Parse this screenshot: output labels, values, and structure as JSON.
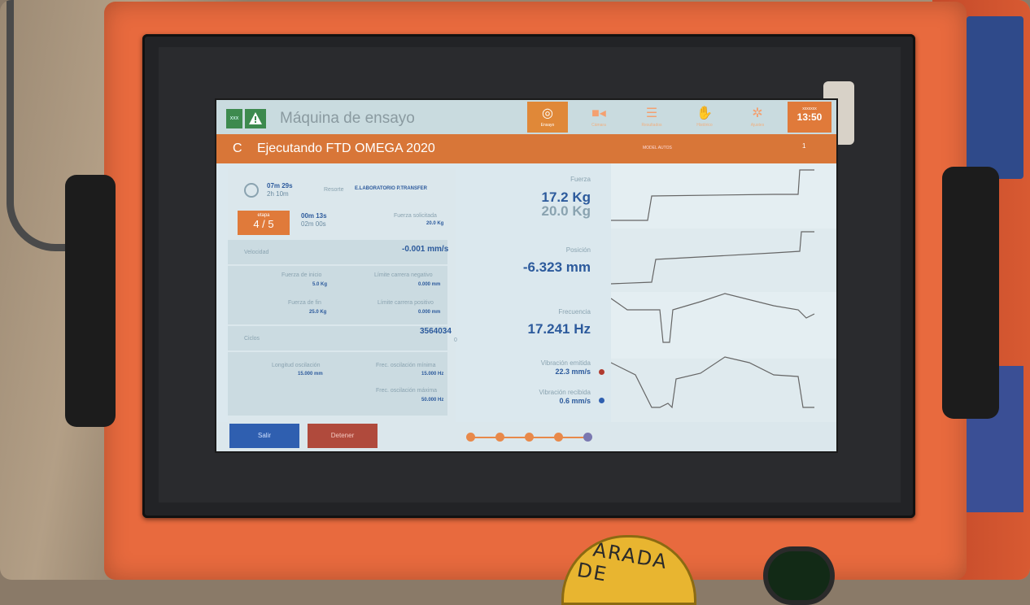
{
  "app": {
    "title": "Máquina de ensayo"
  },
  "header": {
    "green_badge": "xxx",
    "tabs": [
      {
        "label": "Ensayo",
        "icon": "target-icon",
        "active": true
      },
      {
        "label": "Cámara",
        "icon": "camera-icon",
        "active": false
      },
      {
        "label": "Resultados",
        "icon": "menu-icon",
        "active": false
      },
      {
        "label": "Histórico",
        "icon": "hand-icon",
        "active": false
      },
      {
        "label": "Ajustes",
        "icon": "gear-icon",
        "active": false
      }
    ],
    "clock": {
      "date": "xxxxxxx",
      "time": "13:50"
    }
  },
  "status": {
    "prefix": "C",
    "title": "Ejecutando  FTD OMEGA 2020",
    "mode": "MODEL AUTOS",
    "num": "1"
  },
  "left": {
    "time_elapsed": "07m 29s",
    "time_total": "2h 10m",
    "resort_label": "Resorte",
    "resort_value": "E.LABORATORIO P.TRANSFER",
    "etapa_label": "etapa",
    "etapa_value": "4 / 5",
    "etapa_time_elapsed": "00m 13s",
    "etapa_time_total": "02m 00s",
    "fuerza_solicitada_label": "Fuerza solicitada",
    "fuerza_solicitada_value": "20.0 Kg",
    "velocidad_label": "Velocidad",
    "velocidad_value": "-0.001 mm/s",
    "fuerza_inicio_label": "Fuerza de inicio",
    "fuerza_inicio_value": "5.0 Kg",
    "limite_neg_label": "Límite carrera negativo",
    "limite_neg_value": "0.000 mm",
    "fuerza_fin_label": "Fuerza de fin",
    "fuerza_fin_value": "25.0 Kg",
    "limite_pos_label": "Límite carrera positivo",
    "limite_pos_value": "0.000 mm",
    "ciclos_label": "Ciclos",
    "ciclos_value": "3564034",
    "ciclos_sub": "0",
    "longitud_label": "Longitud oscilación",
    "longitud_value": "15.000 mm",
    "frec_min_label": "Frec. oscilación mínima",
    "frec_min_value": "15.000 Hz",
    "frec_max_label": "Frec. oscilación máxima",
    "frec_max_value": "50.000 Hz"
  },
  "mid": {
    "fuerza_label": "Fuerza",
    "fuerza_value": "17.2 Kg",
    "fuerza_target": "20.0 Kg",
    "posicion_label": "Posición",
    "posicion_value": "-6.323 mm",
    "frecuencia_label": "Frecuencia",
    "frecuencia_value": "17.241 Hz",
    "vib_emitida_label": "Vibración emitida",
    "vib_emitida_value": "22.3 mm/s",
    "vib_recibida_label": "Vibración recibida",
    "vib_recibida_value": "0.6 mm/s"
  },
  "colors": {
    "accent": "#e07a3a",
    "value_blue": "#2c5a9c",
    "dot_red": "#b03a2e",
    "dot_blue": "#2f5fb0"
  },
  "footer": {
    "salir": "Salir",
    "detener": "Detener",
    "steps_total": 5,
    "current_step": 5
  },
  "hardware": {
    "estop_label": "PARADA DE"
  }
}
